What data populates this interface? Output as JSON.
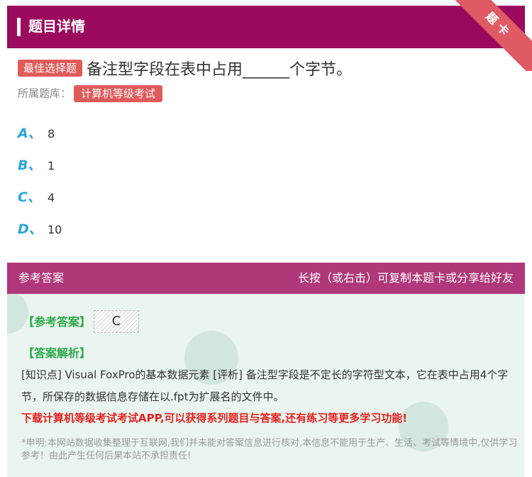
{
  "header": {
    "title": "题目详情"
  },
  "ribbon": {
    "label": "题卡"
  },
  "question": {
    "type_tag": "最佳选择题",
    "text": "备注型字段在表中占用______个字节。",
    "bank_label": "所属题库：",
    "bank_name": "计算机等级考试"
  },
  "options": [
    {
      "letter": "A、",
      "value": "8"
    },
    {
      "letter": "B、",
      "value": "1"
    },
    {
      "letter": "C、",
      "value": "4"
    },
    {
      "letter": "D、",
      "value": "10"
    }
  ],
  "answer_panel": {
    "title": "参考答案",
    "copy_hint": "长按（或右击）可复制本题卡或分享给好友",
    "answer_label": "【参考答案】",
    "answer_value": "C",
    "analysis_label": "【答案解析】",
    "analysis_text": "[知识点] Visual FoxPro的基本数据元素 [评析] 备注型字段是不定长的字符型文本，它在表中占用4个字节，所保存的数据信息存储在以.fpt为扩展名的文件中。",
    "promo": "下载计算机等级考试考试APP,可以获得系列题目与答案,还有练习等更多学习功能!",
    "disclaimer": "*申明:本网站数据收集整理于互联网,我们并未能对答案信息进行核对,本信息不能用于生产、生活、考试等情境中,仅供学习参考！由此产生任何后果本站不承担责任!"
  },
  "colors": {
    "header_bg": "#9c0a5e",
    "answer_header_bg": "#b0387a",
    "tag_bg": "#e15a5a",
    "option_letter": "#2aa6d6",
    "answer_label": "#2eaa4a",
    "promo": "#e8201f"
  }
}
